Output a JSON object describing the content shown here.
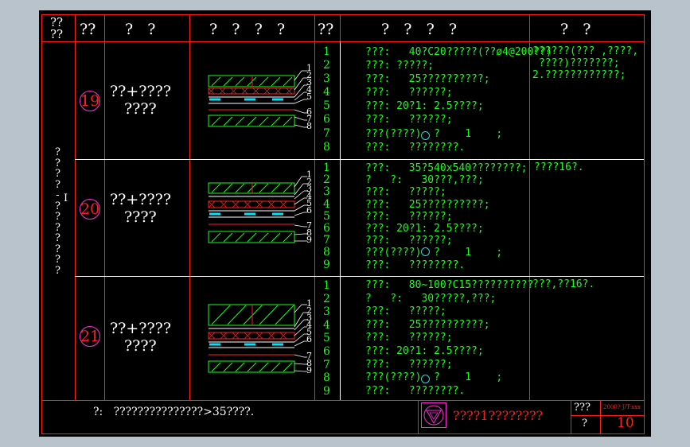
{
  "header": {
    "col1": "??\n??",
    "col2": "??",
    "col3": "?   ?",
    "col4": "?   ?   ?   ?",
    "col5": "??",
    "col6": "?   ?   ?   ?",
    "col7": "?   ?"
  },
  "side_label": "?\n?\n?\n?\n-\n?\n?\n?\n?\n?\n?\n?",
  "side_label_mark": "I",
  "rows": [
    {
      "badge": "19",
      "name_line1": "??+????",
      "name_line2": "????",
      "layer_numbers": [
        "1",
        "2",
        "3",
        "4",
        "5",
        "6",
        "7",
        "8"
      ],
      "lines": [
        "???:   40?C20?????(??ø4@200??)",
        "???: ?????;",
        "???:   25??????????;",
        "???:   ??????;",
        "???: 20?1: 2.5????;",
        "???:   ??????;",
        "???(????)  ?    1    ;",
        "???:   ????????."
      ],
      "note": "??????(??? ,????,\n ????)???????;\n2.????????????;"
    },
    {
      "badge": "20",
      "name_line1": "??+????",
      "name_line2": "????",
      "layer_numbers": [
        "1",
        "2",
        "3",
        "4",
        "5",
        "6",
        "7",
        "8",
        "9"
      ],
      "lines": [
        "???:   35?540x540????????;",
        "?   ?:   30???,???;",
        "???:   ?????;",
        "???:   25??????????;",
        "???:   ??????;",
        "???: 20?1: 2.5????;",
        "???:   ??????;",
        "???(????)  ?    1    ;",
        "???:   ????????."
      ],
      "note": "????16?."
    },
    {
      "badge": "21",
      "name_line1": "??+????",
      "name_line2": "????",
      "layer_numbers": [
        "1",
        "2",
        "3",
        "4",
        "5",
        "6",
        "7",
        "8",
        "9"
      ],
      "lines": [
        "???:   80~100?C15??????????",
        "?   ?:   30?????,???;",
        "???:   ?????;",
        "???:   25??????????;",
        "???:   ??????;",
        "???: 20?1: 2.5????;",
        "???:   ??????;",
        "???(????)  ?    1    ;",
        "???:   ????????."
      ],
      "note": "???,??16?."
    }
  ],
  "footer": {
    "note": "?:   ???????????????>35????.",
    "title": "????1????????",
    "box_top": "???",
    "box_code": "2000? J/T-xxx",
    "box_bottom": "?",
    "sheet_no": "10"
  },
  "colors": {
    "background": "#000000",
    "frame": "#ff1f1f",
    "text_green": "#19ff19",
    "text_white": "#ffffff",
    "badge": "#ff2bd8",
    "hatch": "#19ff19",
    "layer_cyan": "#00e5ff"
  }
}
